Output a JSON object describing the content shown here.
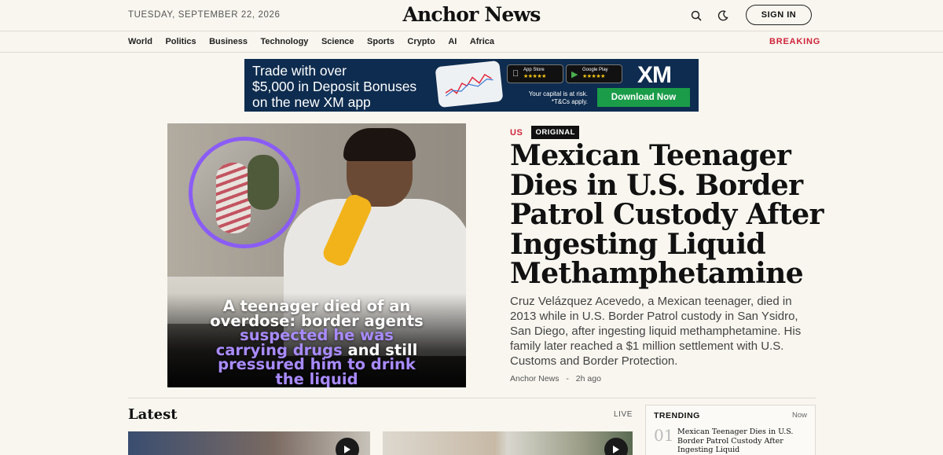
{
  "header": {
    "date": "TUESDAY, SEPTEMBER 22, 2026",
    "brand": "Anchor News",
    "signin_label": "SIGN IN",
    "search_icon": "search-icon",
    "theme_icon": "moon-icon"
  },
  "nav": {
    "items": [
      "World",
      "Politics",
      "Business",
      "Technology",
      "Science",
      "Sports",
      "Crypto",
      "AI",
      "Africa"
    ],
    "breaking": "BREAKING"
  },
  "ad": {
    "lines": [
      "Trade with over",
      "$5,000 in Deposit Bonuses",
      "on the new XM app"
    ],
    "app_store": "App Store",
    "google_play": "Google Play",
    "stars": "★★★★★",
    "logo": "XM",
    "risk_line1": "Your capital is at risk.",
    "risk_line2": "*T&Cs apply.",
    "cta": "Download Now"
  },
  "hero": {
    "category": "US",
    "badge": "ORIGINAL",
    "headline": "Mexican Teenager Dies in U.S. Border Patrol Custody After Ingesting Liquid Methamphetamine",
    "summary": "Cruz Velázquez Acevedo, a Mexican teenager, died in 2013 while in U.S. Border Patrol custody in San Ysidro, San Diego, after ingesting liquid methamphetamine. His family later reached a $1 million settlement with U.S. Customs and Border Protection.",
    "caption_line1": "A teenager died of an",
    "caption_line2": "overdose: border agents",
    "caption_hl1": "suspected he was",
    "caption_hl2": "carrying drugs",
    "caption_rest": " and still",
    "caption_hl3": "pressured him to drink",
    "caption_hl4": "the liquid",
    "source": "Anchor News",
    "separator": "-",
    "time": "2h ago"
  },
  "latest": {
    "title": "Latest",
    "live": "LIVE"
  },
  "trending": {
    "title": "TRENDING",
    "now": "Now",
    "items": [
      {
        "num": "01",
        "text": "Mexican Teenager Dies in U.S. Border Patrol Custody After Ingesting Liquid Methamphetamine"
      }
    ]
  }
}
